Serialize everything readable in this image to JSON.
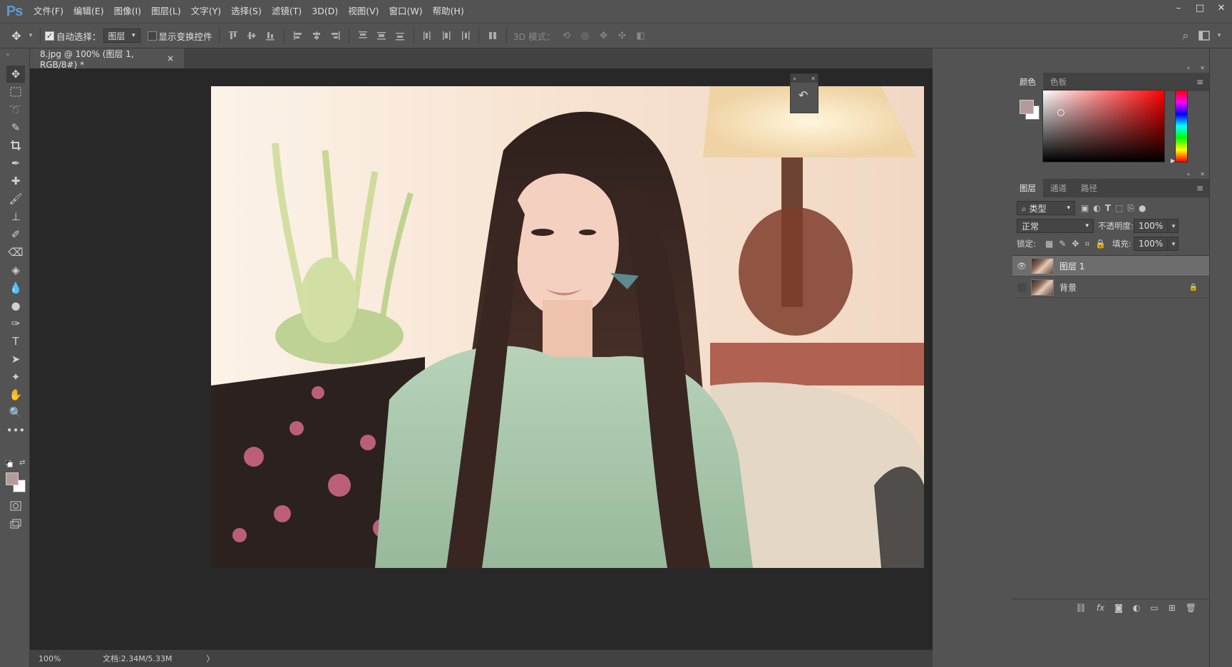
{
  "app": {
    "logo": "Ps"
  },
  "menu": [
    {
      "label": "文件(F)"
    },
    {
      "label": "编辑(E)"
    },
    {
      "label": "图像(I)"
    },
    {
      "label": "图层(L)"
    },
    {
      "label": "文字(Y)"
    },
    {
      "label": "选择(S)"
    },
    {
      "label": "滤镜(T)"
    },
    {
      "label": "3D(D)"
    },
    {
      "label": "视图(V)"
    },
    {
      "label": "窗口(W)"
    },
    {
      "label": "帮助(H)"
    }
  ],
  "window_controls": {
    "minimize": "–",
    "maximize": "□",
    "close": "✕"
  },
  "options": {
    "auto_select_label": "自动选择：",
    "auto_select_checked": true,
    "auto_select_value": "图层",
    "show_transform_label": "显示变换控件",
    "show_transform_checked": false,
    "mode_3d_label": "3D 模式："
  },
  "document": {
    "tab_title": "8.jpg @ 100% (图层 1, RGB/8#) *",
    "tab_close": "×"
  },
  "status": {
    "zoom": "100%",
    "doc_info": "文档:2.34M/5.33M",
    "arrow": "〉"
  },
  "color_panel": {
    "tabs": [
      {
        "label": "颜色",
        "active": true
      },
      {
        "label": "色板",
        "active": false
      }
    ],
    "foreground": "#b49b9a",
    "background": "#ffffff",
    "hue": "#ff0000"
  },
  "layers_panel": {
    "tabs": [
      {
        "label": "图层",
        "active": true
      },
      {
        "label": "通道",
        "active": false
      },
      {
        "label": "路径",
        "active": false
      }
    ],
    "filter_label": "类型",
    "blend_mode": "正常",
    "opacity_label": "不透明度:",
    "opacity_value": "100%",
    "lock_label": "锁定:",
    "fill_label": "填充:",
    "fill_value": "100%",
    "layers": [
      {
        "name": "图层 1",
        "visible": true,
        "selected": true,
        "locked": false
      },
      {
        "name": "背景",
        "visible": false,
        "selected": false,
        "locked": true
      }
    ]
  },
  "icons": {
    "move": "✥",
    "eye": "👁",
    "lock": "🔒",
    "search": "⌕",
    "menu": "≡",
    "collapse": "«",
    "expand": "»"
  }
}
